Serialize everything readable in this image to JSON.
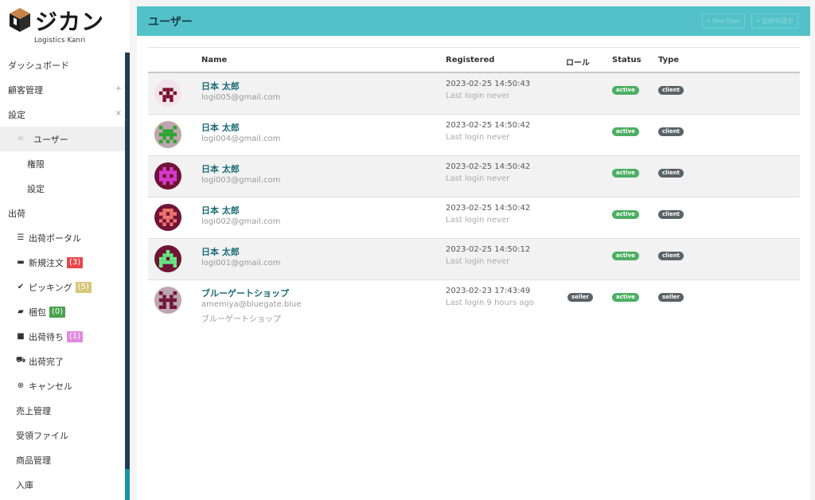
{
  "logo": {
    "text": "ジカン",
    "sub": "Logistics Kanri"
  },
  "sidebar": {
    "items": [
      {
        "label": "ダッシュボード",
        "level": 0
      },
      {
        "label": "顧客管理",
        "level": 0,
        "toggle": "+"
      },
      {
        "label": "設定",
        "level": 0,
        "toggle": "×"
      },
      {
        "label": "ユーザー",
        "level": 1,
        "active": true,
        "icon": "≡"
      },
      {
        "label": "権限",
        "level": 2
      },
      {
        "label": "設定",
        "level": 2
      },
      {
        "label": "出荷",
        "level": 0
      },
      {
        "label": "出荷ポータル",
        "level": 1,
        "icon": "☰"
      },
      {
        "label": "新規注文",
        "level": 1,
        "icon": "▬",
        "count": "(3)",
        "count_color": "#e8484a"
      },
      {
        "label": "ピッキング",
        "level": 1,
        "icon": "✔",
        "count": "(5)",
        "count_color": "#d8c77a"
      },
      {
        "label": "梱包",
        "level": 1,
        "icon": "▰",
        "count": "(0)",
        "count_color": "#49a14f"
      },
      {
        "label": "出荷待ち",
        "level": 1,
        "icon": "■",
        "count": "(1)",
        "count_color": "#e28adf"
      },
      {
        "label": "出荷完了",
        "level": 1,
        "icon": "⛟"
      },
      {
        "label": "キャンセル",
        "level": 1,
        "icon": "⊗"
      },
      {
        "label": "売上管理",
        "level": 1
      },
      {
        "label": "受領ファイル",
        "level": 1
      },
      {
        "label": "商品管理",
        "level": 1
      },
      {
        "label": "入庫",
        "level": 1
      }
    ]
  },
  "header": {
    "title": "ユーザー",
    "new_user_button": "+ New User",
    "second_button": "+ 出荷申請中"
  },
  "table": {
    "columns": {
      "name": "Name",
      "registered": "Registered",
      "role": "ロール",
      "status": "Status",
      "type": "Type"
    },
    "rows": [
      {
        "name": "日本 太郎",
        "email": "logi005@gmail.com",
        "extra": "",
        "registered": "2023-02-25 14:50:43",
        "last_login": "Last login never",
        "role": "",
        "status": "active",
        "type": "client",
        "avatar_bg": "#f3e3ea",
        "avatar_fg": "#7a1030"
      },
      {
        "name": "日本 太郎",
        "email": "logi004@gmail.com",
        "extra": "",
        "registered": "2023-02-25 14:50:42",
        "last_login": "Last login never",
        "role": "",
        "status": "active",
        "type": "client",
        "avatar_bg": "#bda6ae",
        "avatar_fg": "#2aa52f"
      },
      {
        "name": "日本 太郎",
        "email": "logi003@gmail.com",
        "extra": "",
        "registered": "2023-02-25 14:50:42",
        "last_login": "Last login never",
        "role": "",
        "status": "active",
        "type": "client",
        "avatar_bg": "#701436",
        "avatar_fg": "#d93ad1"
      },
      {
        "name": "日本 太郎",
        "email": "logi002@gmail.com",
        "extra": "",
        "registered": "2023-02-25 14:50:42",
        "last_login": "Last login never",
        "role": "",
        "status": "active",
        "type": "client",
        "avatar_bg": "#701436",
        "avatar_fg": "#f1766e"
      },
      {
        "name": "日本 太郎",
        "email": "logi001@gmail.com",
        "extra": "",
        "registered": "2023-02-25 14:50:12",
        "last_login": "Last login never",
        "role": "",
        "status": "active",
        "type": "client",
        "avatar_bg": "#701436",
        "avatar_fg": "#66ea86"
      },
      {
        "name": "ブルーゲートショップ",
        "email": "amemiya@bluegate.blue",
        "extra": "ブルーゲートショップ",
        "registered": "2023-02-23 17:43:49",
        "last_login": "Last login 9 hours ago",
        "role": "seller",
        "status": "active",
        "type": "seller",
        "avatar_bg": "#bda6ae",
        "avatar_fg": "#701436"
      }
    ]
  },
  "colors": {
    "header": "#52c2c8",
    "status_active": "#4caf63",
    "role_pill": "#5a6368",
    "type_pill": "#5a6368",
    "name_link": "#1b6b78"
  }
}
